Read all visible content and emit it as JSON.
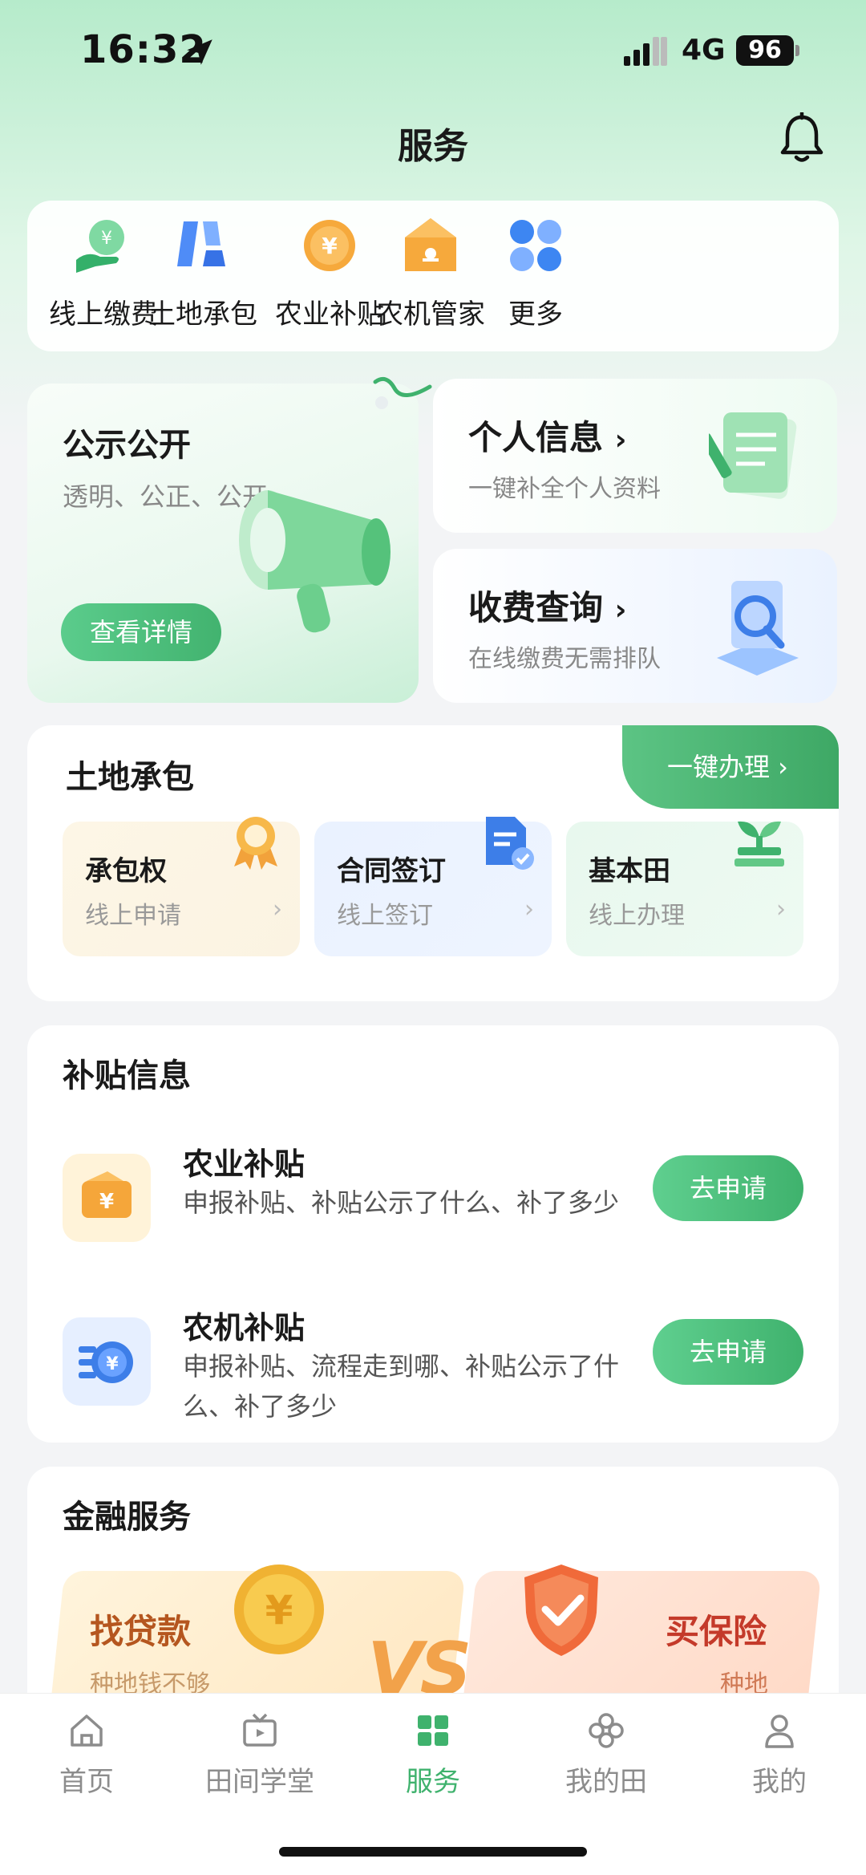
{
  "status_bar": {
    "time": "16:32",
    "network": "4G",
    "battery": "96"
  },
  "header": {
    "title": "服务"
  },
  "quick_services": [
    {
      "label": "线上缴费",
      "icon": "payment-hand-icon"
    },
    {
      "label": "土地承包",
      "icon": "land-blocks-icon"
    },
    {
      "label": "农业补贴",
      "icon": "yuan-coin-icon"
    },
    {
      "label": "农机管家",
      "icon": "machine-house-icon"
    },
    {
      "label": "更多",
      "icon": "more-grid-icon"
    }
  ],
  "announcement": {
    "title": "公示公开",
    "subtitle": "透明、公正、公开",
    "button": "查看详情"
  },
  "personal_info": {
    "title": "个人信息",
    "arrow": "›",
    "subtitle": "一键补全个人资料"
  },
  "fee_query": {
    "title": "收费查询",
    "arrow": "›",
    "subtitle": "在线缴费无需排队"
  },
  "land": {
    "title": "土地承包",
    "action": "一键办理 ›",
    "tiles": [
      {
        "title": "承包权",
        "subtitle": "线上申请",
        "arrow": "›",
        "icon": "award-medal-icon"
      },
      {
        "title": "合同签订",
        "subtitle": "线上签订",
        "arrow": "›",
        "icon": "contract-doc-icon"
      },
      {
        "title": "基本田",
        "subtitle": "线上办理",
        "arrow": "›",
        "icon": "sprout-icon"
      }
    ]
  },
  "subsidy": {
    "title": "补贴信息",
    "items": [
      {
        "name": "农业补贴",
        "desc": "申报补贴、补贴公示了什么、补了多少",
        "button": "去申请",
        "icon": "wallet-yuan-icon"
      },
      {
        "name": "农机补贴",
        "desc": "申报补贴、流程走到哪、补贴公示了什么、补了多少",
        "button": "去申请",
        "icon": "blue-yuan-coin-icon"
      }
    ]
  },
  "finance": {
    "title": "金融服务",
    "loan": {
      "title": "找贷款",
      "subtitle": "种地钱不够"
    },
    "vs": "VS",
    "insurance": {
      "title": "买保险",
      "subtitle": "种地"
    }
  },
  "tabs": [
    {
      "label": "首页",
      "icon": "home-icon"
    },
    {
      "label": "田间学堂",
      "icon": "tv-icon"
    },
    {
      "label": "服务",
      "icon": "grid-icon",
      "active": true
    },
    {
      "label": "我的田",
      "icon": "field-flower-icon"
    },
    {
      "label": "我的",
      "icon": "user-icon"
    }
  ],
  "colors": {
    "accent": "#3fb26d",
    "background": "#f3f4f6"
  }
}
